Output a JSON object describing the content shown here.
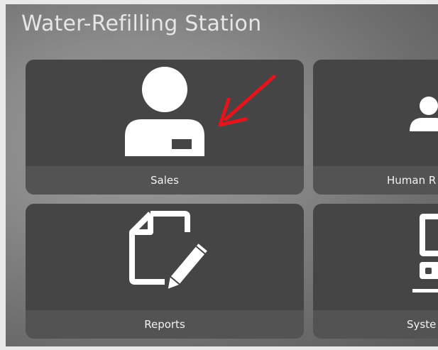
{
  "app": {
    "title": "Water-Refilling Station"
  },
  "tiles": [
    {
      "label": "Sales",
      "icon": "person-badge-icon"
    },
    {
      "label": "Human R",
      "icon": "person-icon"
    },
    {
      "label": "Reports",
      "icon": "document-pencil-icon"
    },
    {
      "label": "Syste",
      "icon": "computer-icon"
    }
  ],
  "annotation": {
    "icon": "red-arrow-icon",
    "color": "#e3141b"
  },
  "colors": {
    "tile_background": "#454545",
    "tile_caption_bar": "#535353",
    "icon_fill": "#ffffff",
    "title_text": "#e6e6e6"
  }
}
